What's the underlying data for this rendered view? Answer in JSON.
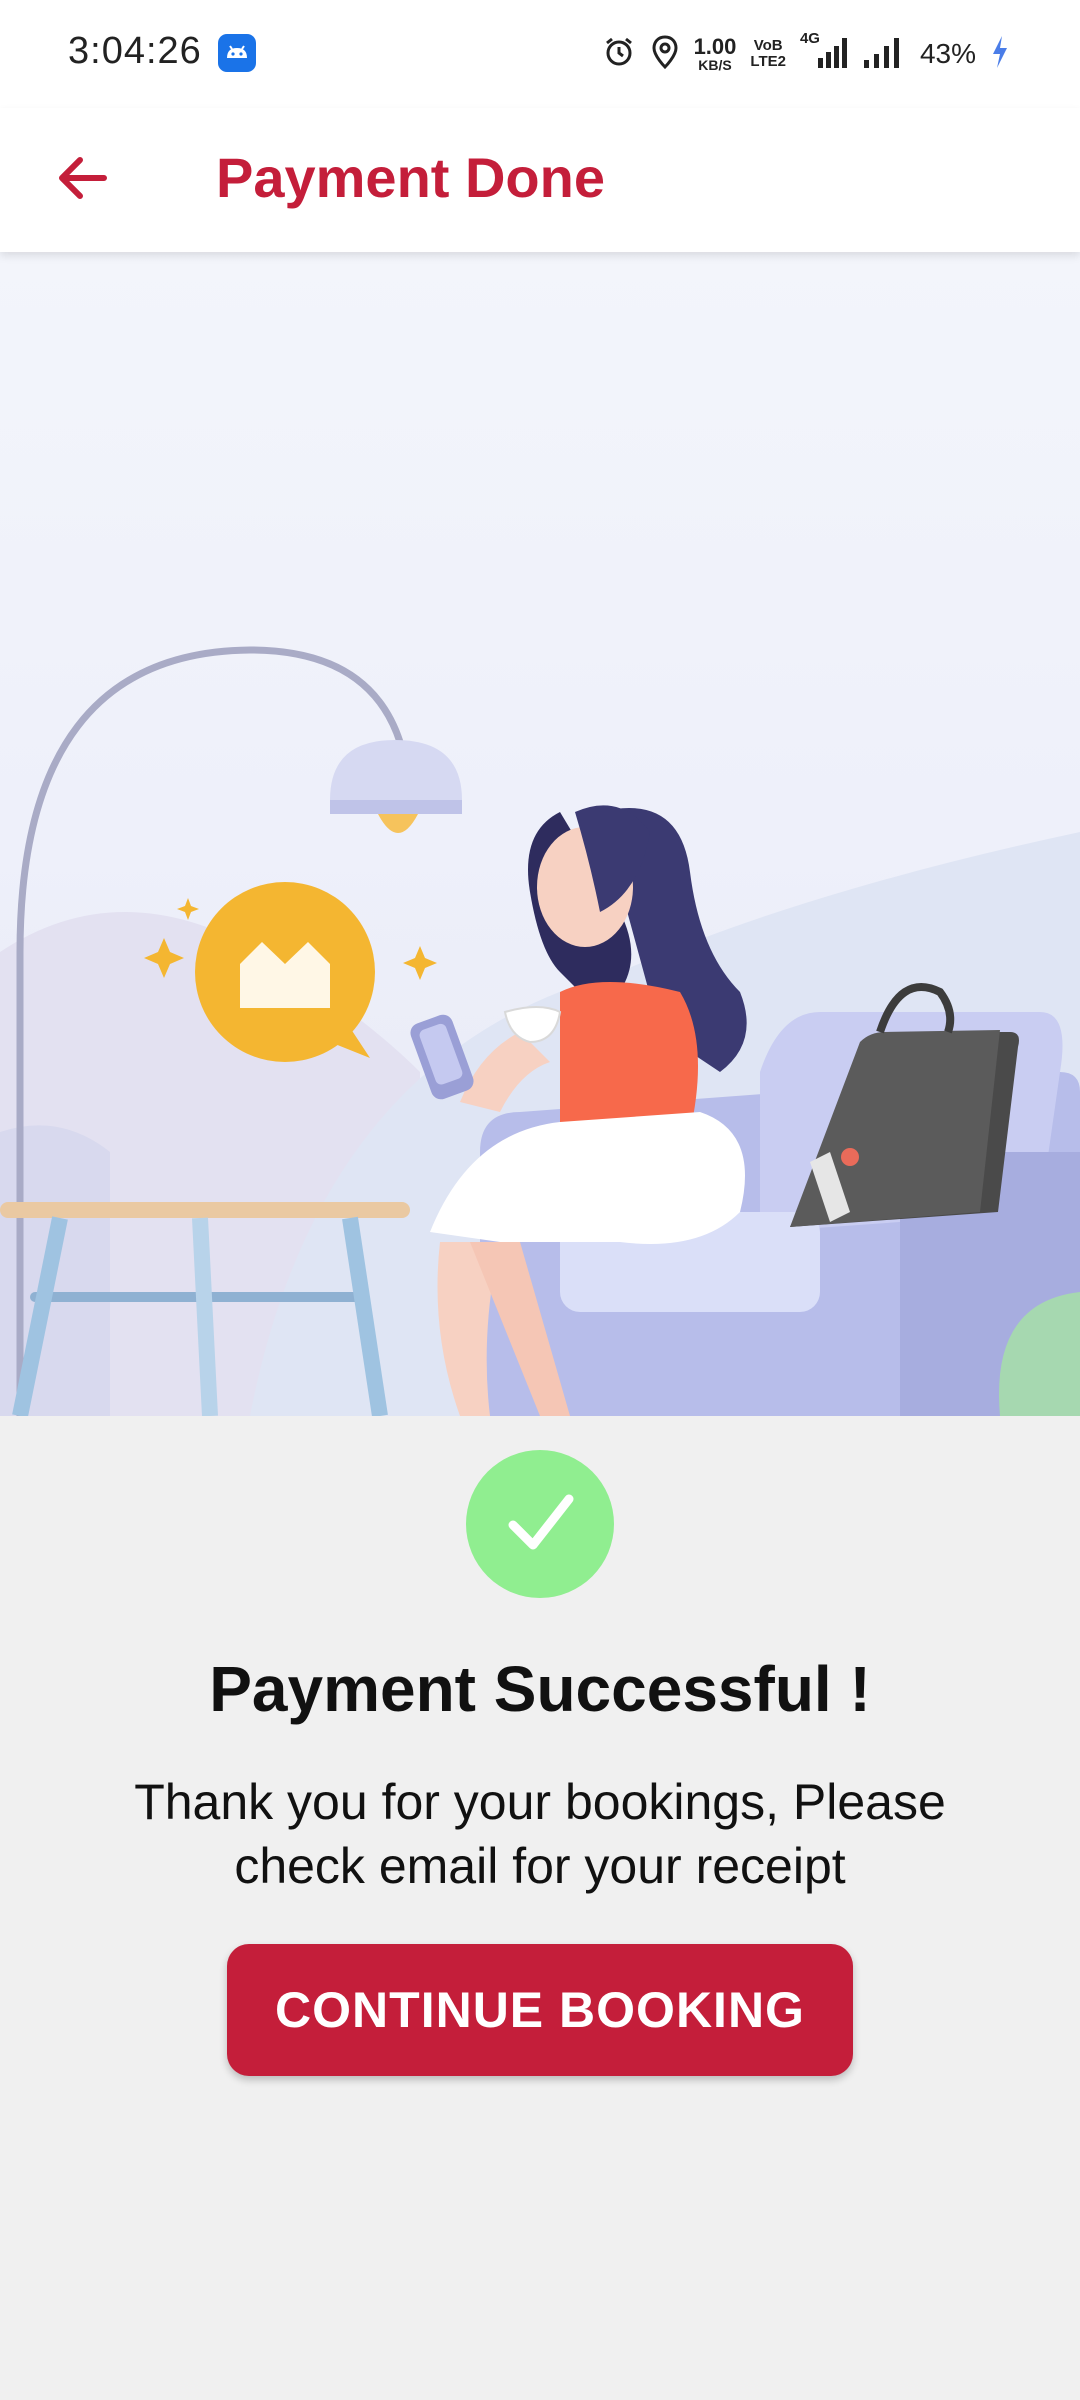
{
  "status_bar": {
    "time": "3:04:26",
    "network_speed_value": "1.00",
    "network_speed_unit": "KB/S",
    "volte_top": "VoB",
    "volte_bottom": "LTE2",
    "network_type": "4G",
    "battery": "43%"
  },
  "app_bar": {
    "title": "Payment Done"
  },
  "main": {
    "success_title": "Payment Successful !",
    "success_message": "Thank you for your bookings, Please check email for your receipt",
    "continue_button_label": "CONTINUE BOOKING"
  },
  "colors": {
    "brand": "#c41e3a",
    "success": "#90ee90",
    "background": "#f0f0f0"
  }
}
